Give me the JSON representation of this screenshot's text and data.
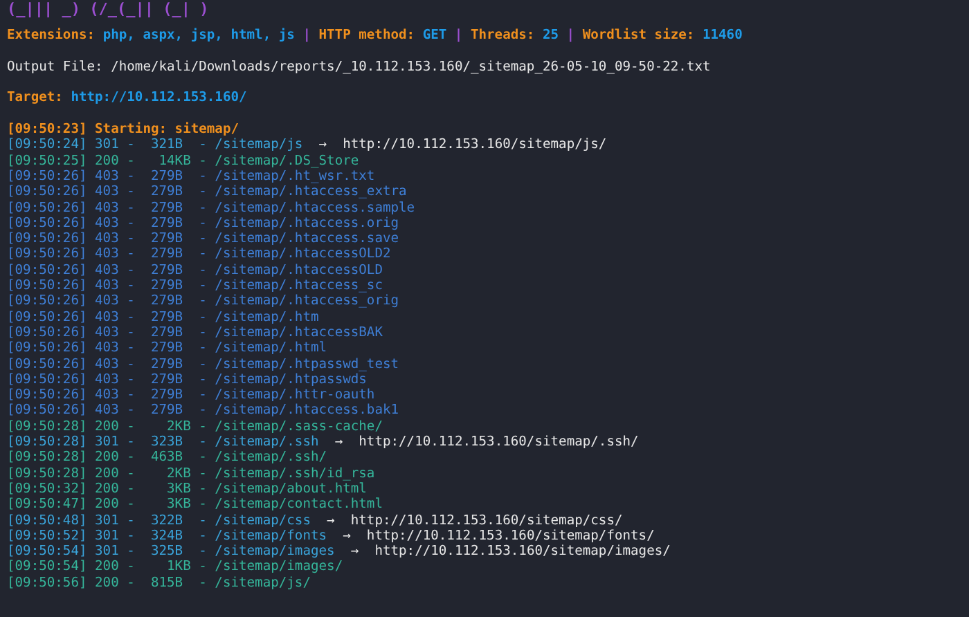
{
  "banner": "(_||| _) (/_(_|| (_| )",
  "config": [
    {
      "kind": "label",
      "text": "Extensions:"
    },
    {
      "kind": "value",
      "text": "php, aspx, jsp, html, js"
    },
    {
      "kind": "sep",
      "text": "|"
    },
    {
      "kind": "label",
      "text": "HTTP method:"
    },
    {
      "kind": "value",
      "text": "GET"
    },
    {
      "kind": "sep",
      "text": "|"
    },
    {
      "kind": "label",
      "text": "Threads:"
    },
    {
      "kind": "value",
      "text": "25"
    },
    {
      "kind": "sep",
      "text": "|"
    },
    {
      "kind": "label",
      "text": "Wordlist size:"
    },
    {
      "kind": "value",
      "text": "11460"
    }
  ],
  "output_file": "Output File: /home/kali/Downloads/reports/_10.112.153.160/_sitemap_26-05-10_09-50-22.txt",
  "target": {
    "label": "Target:",
    "url": "http://10.112.153.160/"
  },
  "start": "[09:50:23] Starting: sitemap/",
  "rows": [
    {
      "kind": "redirect",
      "text": "[09:50:24] 301 -  321B  - /sitemap/js",
      "arrow": "→",
      "url": "http://10.112.153.160/sitemap/js/"
    },
    {
      "kind": "ok",
      "text": "[09:50:25] 200 -   14KB - /sitemap/.DS_Store"
    },
    {
      "kind": "forbidden",
      "text": "[09:50:26] 403 -  279B  - /sitemap/.ht_wsr.txt"
    },
    {
      "kind": "forbidden",
      "text": "[09:50:26] 403 -  279B  - /sitemap/.htaccess_extra"
    },
    {
      "kind": "forbidden",
      "text": "[09:50:26] 403 -  279B  - /sitemap/.htaccess.sample"
    },
    {
      "kind": "forbidden",
      "text": "[09:50:26] 403 -  279B  - /sitemap/.htaccess.orig"
    },
    {
      "kind": "forbidden",
      "text": "[09:50:26] 403 -  279B  - /sitemap/.htaccess.save"
    },
    {
      "kind": "forbidden",
      "text": "[09:50:26] 403 -  279B  - /sitemap/.htaccessOLD2"
    },
    {
      "kind": "forbidden",
      "text": "[09:50:26] 403 -  279B  - /sitemap/.htaccessOLD"
    },
    {
      "kind": "forbidden",
      "text": "[09:50:26] 403 -  279B  - /sitemap/.htaccess_sc"
    },
    {
      "kind": "forbidden",
      "text": "[09:50:26] 403 -  279B  - /sitemap/.htaccess_orig"
    },
    {
      "kind": "forbidden",
      "text": "[09:50:26] 403 -  279B  - /sitemap/.htm"
    },
    {
      "kind": "forbidden",
      "text": "[09:50:26] 403 -  279B  - /sitemap/.htaccessBAK"
    },
    {
      "kind": "forbidden",
      "text": "[09:50:26] 403 -  279B  - /sitemap/.html"
    },
    {
      "kind": "forbidden",
      "text": "[09:50:26] 403 -  279B  - /sitemap/.htpasswd_test"
    },
    {
      "kind": "forbidden",
      "text": "[09:50:26] 403 -  279B  - /sitemap/.htpasswds"
    },
    {
      "kind": "forbidden",
      "text": "[09:50:26] 403 -  279B  - /sitemap/.httr-oauth"
    },
    {
      "kind": "forbidden",
      "text": "[09:50:26] 403 -  279B  - /sitemap/.htaccess.bak1"
    },
    {
      "kind": "ok",
      "text": "[09:50:28] 200 -    2KB - /sitemap/.sass-cache/"
    },
    {
      "kind": "redirect",
      "text": "[09:50:28] 301 -  323B  - /sitemap/.ssh",
      "arrow": "→",
      "url": "http://10.112.153.160/sitemap/.ssh/"
    },
    {
      "kind": "ok",
      "text": "[09:50:28] 200 -  463B  - /sitemap/.ssh/"
    },
    {
      "kind": "ok",
      "text": "[09:50:28] 200 -    2KB - /sitemap/.ssh/id_rsa"
    },
    {
      "kind": "ok",
      "text": "[09:50:32] 200 -    3KB - /sitemap/about.html"
    },
    {
      "kind": "ok",
      "text": "[09:50:47] 200 -    3KB - /sitemap/contact.html"
    },
    {
      "kind": "redirect",
      "text": "[09:50:48] 301 -  322B  - /sitemap/css",
      "arrow": "→",
      "url": "http://10.112.153.160/sitemap/css/"
    },
    {
      "kind": "redirect",
      "text": "[09:50:52] 301 -  324B  - /sitemap/fonts",
      "arrow": "→",
      "url": "http://10.112.153.160/sitemap/fonts/"
    },
    {
      "kind": "redirect",
      "text": "[09:50:54] 301 -  325B  - /sitemap/images",
      "arrow": "→",
      "url": "http://10.112.153.160/sitemap/images/"
    },
    {
      "kind": "ok",
      "text": "[09:50:54] 200 -    1KB - /sitemap/images/"
    },
    {
      "kind": "ok",
      "text": "[09:50:56] 200 -  815B  - /sitemap/js/"
    }
  ]
}
